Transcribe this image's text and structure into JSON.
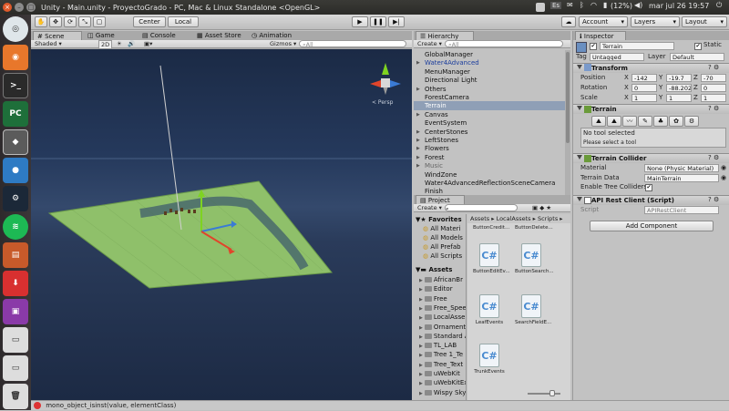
{
  "window": {
    "title": "Unity - Main.unity - ProyectoGrado - PC, Mac & Linux Standalone <OpenGL>",
    "clock": "mar jul 26 19:57",
    "battery": "(12%)",
    "keyboard": "Es"
  },
  "toolbar": {
    "center": "Center",
    "local": "Local",
    "account": "Account",
    "layers": "Layers",
    "layout": "Layout"
  },
  "scene": {
    "tabs": [
      "Scene",
      "Game",
      "Console",
      "Asset Store",
      "Animation"
    ],
    "shading": "Shaded",
    "mode2d": "2D",
    "gizmos": "Gizmos",
    "search_placeholder": "All",
    "persp": "< Persp"
  },
  "hierarchy": {
    "tab": "Hierarchy",
    "create": "Create",
    "search_placeholder": "All",
    "items": [
      {
        "label": "GlobalManager",
        "arrow": "",
        "color": "#111"
      },
      {
        "label": "Water4Advanced",
        "arrow": "▶",
        "color": "#1a3c9c"
      },
      {
        "label": "MenuManager",
        "arrow": "",
        "color": "#111"
      },
      {
        "label": "Directional Light",
        "arrow": "",
        "color": "#111"
      },
      {
        "label": "Others",
        "arrow": "▶",
        "color": "#111"
      },
      {
        "label": "ForestCamera",
        "arrow": "",
        "color": "#111"
      },
      {
        "label": "Terrain",
        "arrow": "",
        "color": "#fff",
        "selected": true
      },
      {
        "label": "Canvas",
        "arrow": "▶",
        "color": "#111"
      },
      {
        "label": "EventSystem",
        "arrow": "",
        "color": "#111"
      },
      {
        "label": "CenterStones",
        "arrow": "▶",
        "color": "#111"
      },
      {
        "label": "LeftStones",
        "arrow": "▶",
        "color": "#111"
      },
      {
        "label": "Flowers",
        "arrow": "▶",
        "color": "#111"
      },
      {
        "label": "Forest",
        "arrow": "▶",
        "color": "#111"
      },
      {
        "label": "Music",
        "arrow": "▶",
        "color": "#666"
      },
      {
        "label": "WindZone",
        "arrow": "",
        "color": "#111"
      },
      {
        "label": "Water4AdvancedReflectionSceneCamera",
        "arrow": "",
        "color": "#111"
      },
      {
        "label": "Finish",
        "arrow": "",
        "color": "#111"
      }
    ]
  },
  "project": {
    "tab": "Project",
    "create": "Create",
    "favorites_label": "Favorites",
    "favorites": [
      "All Materi",
      "All Models",
      "All Prefab",
      "All Scripts"
    ],
    "assets_label": "Assets",
    "folders": [
      "AfricanBr",
      "Editor",
      "Free",
      "Free_Spee",
      "LocalAsse",
      "Ornament",
      "Standard A",
      "TL_LAB",
      "Tree 1_Te",
      "Tree_Text",
      "uWebKit",
      "uWebKitEx",
      "Wispy Sky"
    ],
    "breadcrumb": [
      "Assets",
      "LocalAssets",
      "Scripts"
    ],
    "top_assets": [
      "ButtonCredit...",
      "ButtonDelete..."
    ],
    "assets": [
      "ButtonEditEv...",
      "ButtonSearch...",
      "LeafEvents",
      "SearchFieldE...",
      "TrunkEvents"
    ]
  },
  "inspector": {
    "tab": "Inspector",
    "object_name": "Terrain",
    "static_label": "Static",
    "tag_label": "Tag",
    "tag_value": "Untagged",
    "layer_label": "Layer",
    "layer_value": "Default",
    "transform": {
      "title": "Transform",
      "position_label": "Position",
      "rotation_label": "Rotation",
      "scale_label": "Scale",
      "position": {
        "x": "-142",
        "y": "-19.7",
        "z": "-70"
      },
      "rotation": {
        "x": "0",
        "y": "-88.202",
        "z": "0"
      },
      "scale": {
        "x": "1",
        "y": "1",
        "z": "1"
      }
    },
    "terrain": {
      "title": "Terrain",
      "no_tool": "No tool selected",
      "please": "Please select a tool"
    },
    "collider": {
      "title": "Terrain Collider",
      "material_label": "Material",
      "material_value": "None (Physic Material)",
      "data_label": "Terrain Data",
      "data_value": "MainTerrain",
      "trees_label": "Enable Tree Colliders"
    },
    "api": {
      "title": "API Rest Client (Script)",
      "script_label": "Script",
      "script_value": "APIRestClient"
    },
    "add_component": "Add Component"
  },
  "status": {
    "message": "mono_object_isinst(value, elementClass)"
  },
  "colors": {
    "sky_top": "#1b2a45",
    "terrain": "#8fc06a",
    "selection": "#8f9fb6"
  }
}
